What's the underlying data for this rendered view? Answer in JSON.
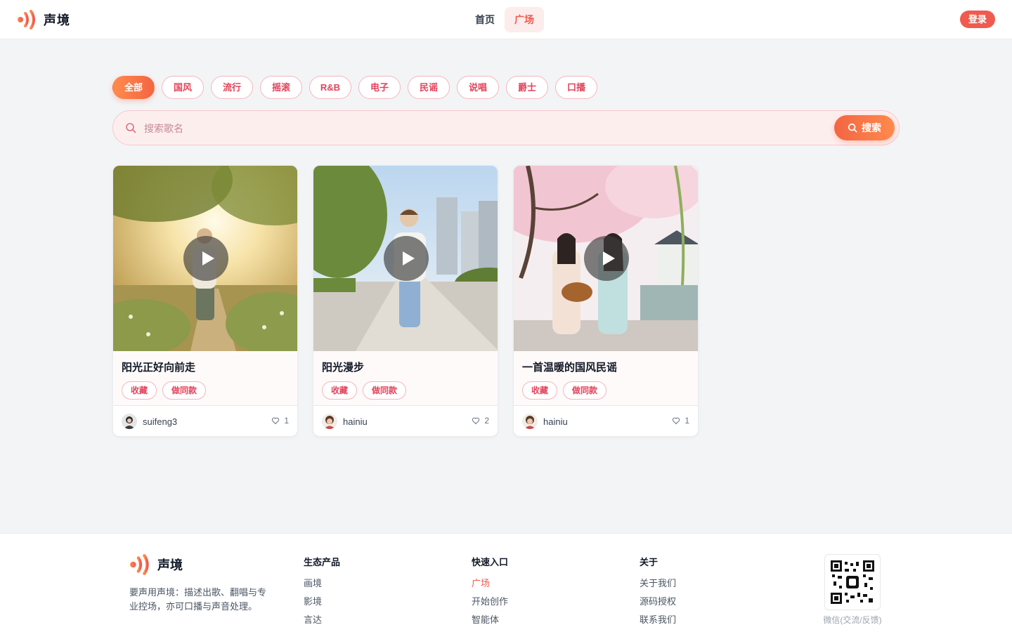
{
  "brand": {
    "name": "声境",
    "accent": "#f05a4f"
  },
  "nav": {
    "items": [
      "首页",
      "广场"
    ],
    "active": "广场"
  },
  "header": {
    "login_label": "登录"
  },
  "categories": [
    "全部",
    "国风",
    "流行",
    "摇滚",
    "R&B",
    "电子",
    "民谣",
    "说唱",
    "爵士",
    "口播"
  ],
  "active_category": "全部",
  "search": {
    "placeholder": "搜索歌名",
    "button_label": "搜索"
  },
  "cards": [
    {
      "title": "阳光正好向前走",
      "tags": [
        "收藏",
        "做同款"
      ],
      "author": "suifeng3",
      "likes": "1",
      "image": "sunny-meadow-walker"
    },
    {
      "title": "阳光漫步",
      "tags": [
        "收藏",
        "做同款"
      ],
      "author": "hainiu",
      "likes": "2",
      "image": "city-path-walker"
    },
    {
      "title": "一首温暖的国风民谣",
      "tags": [
        "收藏",
        "做同款"
      ],
      "author": "hainiu",
      "likes": "1",
      "image": "cherry-blossom-guitar"
    }
  ],
  "footer": {
    "brand_name": "声境",
    "description": "要声用声境：描述出歌、翻唱与专业控场，亦可口播与声音处理。",
    "columns": [
      {
        "title": "生态产品",
        "links": [
          "画境",
          "影境",
          "言达"
        ]
      },
      {
        "title": "快速入口",
        "links": [
          "广场",
          "开始创作",
          "智能体"
        ]
      },
      {
        "title": "关于",
        "links": [
          "关于我们",
          "源码授权",
          "联系我们"
        ]
      }
    ],
    "qr_caption": "微信(交流/反馈)"
  },
  "icons": {
    "search": "search-icon",
    "play": "play-icon",
    "like": "heart-icon",
    "logo": "sound-wave-logo"
  }
}
